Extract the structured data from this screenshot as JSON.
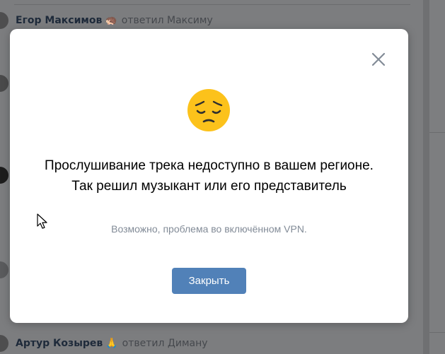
{
  "background": {
    "comments": [
      {
        "author": "Егор Максимов",
        "emoji": "🦔",
        "reply_text": "ответил Максиму"
      },
      {
        "author": "Артур Козырев",
        "emoji": "🙏",
        "reply_text": "ответил Диману"
      }
    ]
  },
  "modal": {
    "icon": "pensive-face-icon",
    "title": "Прослушивание трека недоступно в вашем регионе. Так решил музыкант или его представитель",
    "hint": "Возможно, проблема во включённом VPN.",
    "close_button_label": "Закрыть",
    "close_icon": "close-icon"
  },
  "colors": {
    "accent": "#5181b8",
    "hint_text": "#828b97",
    "overlay": "#7c7d7f"
  }
}
